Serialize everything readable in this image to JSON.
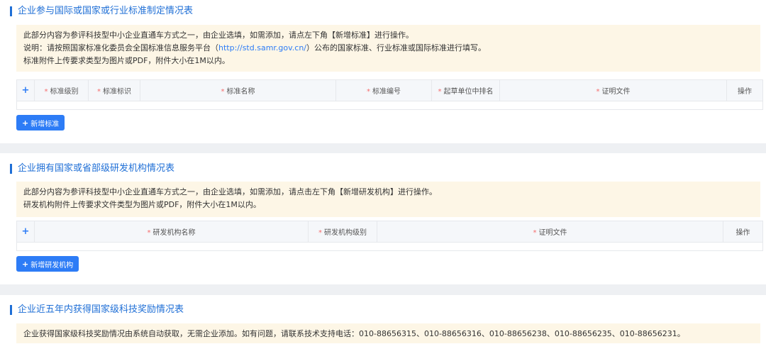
{
  "section1": {
    "title": "企业参与国际或国家或行业标准制定情况表",
    "notice": [
      "此部分内容为参评科技型中小企业直通车方式之一，由企业选填，如需添加，请点左下角【新增标准】进行操作。",
      "说明：请按照国家标准化委员会全国标准信息服务平台（",
      "http://std.samr.gov.cn/",
      "）公布的国家标准、行业标准或国际标准进行填写。",
      "标准附件上传要求类型为图片或PDF，附件大小在1M以内。"
    ],
    "columns": [
      "标准级别",
      "标准标识",
      "标准名称",
      "标准编号",
      "起草单位中排名",
      "证明文件",
      "操作"
    ],
    "add_label": "新增标准"
  },
  "section2": {
    "title": "企业拥有国家或省部级研发机构情况表",
    "notice": [
      "此部分内容为参评科技型中小企业直通车方式之一，由企业选填，如需添加，请点击左下角【新增研发机构】进行操作。",
      "研发机构附件上传要求文件类型为图片或PDF，附件大小在1M以内。"
    ],
    "columns": [
      "研发机构名称",
      "研发机构级别",
      "证明文件",
      "操作"
    ],
    "add_label": "新增研发机构"
  },
  "section3": {
    "title": "企业近五年内获得国家级科技奖励情况表",
    "notice": "企业获得国家级科技奖励情况由系统自动获取，无需企业添加。如有问题，请联系技术支持电话：010-88656315、010-88656316、010-88656238、010-88656235、010-88656231。"
  },
  "req_mark": "*",
  "plus_symbol": "+",
  "colors": {
    "accent": "#2d7cf6",
    "notice_bg": "#fdf6e6",
    "required": "#f56c6c"
  }
}
